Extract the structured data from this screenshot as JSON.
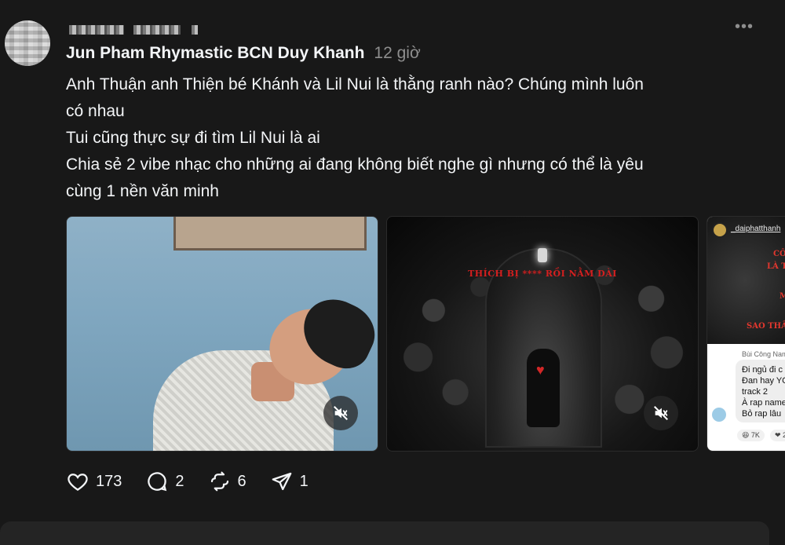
{
  "post": {
    "author": "Jun Pham Rhymastic BCN Duy Khanh",
    "time": "12 giờ",
    "lines": [
      "Anh Thuận anh Thiện bé Khánh và Lil Nui là thằng ranh nào? Chúng mình luôn",
      "có nhau",
      "Tui cũng thực sự đi tìm Lil Nui là ai",
      "Chia sẻ 2 vibe nhạc cho những ai đang không biết nghe gì nhưng có thể là yêu",
      "cùng 1 nền văn minh"
    ],
    "more_icon": "more-icon"
  },
  "media": {
    "video2_title": "THÍCH BỊ **** RỒI NẰM DÀI",
    "shot": {
      "username": "_daiphatthanh",
      "red_lines": [
        "CÔ",
        "LÀ T",
        "M",
        "SAO THẦN"
      ],
      "commenter": "Bùi Công Nam",
      "comment_lines": [
        "Đi ngủ đi c",
        "Đan hay YC",
        "track 2",
        "À rap name",
        "Bỏ rap lâu"
      ],
      "reaction1": "😆 7K",
      "reaction2": "❤ 2"
    }
  },
  "actions": {
    "likes": "173",
    "comments": "2",
    "reposts": "6",
    "shares": "1"
  },
  "colors": {
    "background": "#181818",
    "text": "#f3f5f7",
    "muted": "#8e8e8e"
  }
}
